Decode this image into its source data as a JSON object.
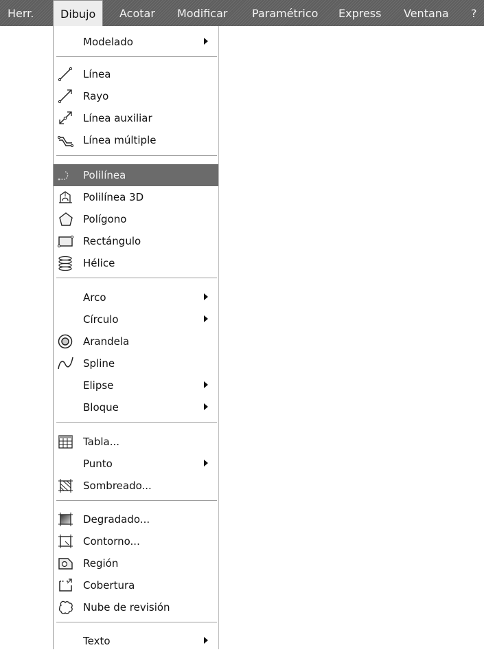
{
  "menubar": {
    "items": [
      "Herr.",
      "Dibujo",
      "Acotar",
      "Modificar",
      "Paramétrico",
      "Express",
      "Ventana",
      "?"
    ],
    "active": "Dibujo"
  },
  "menu": {
    "items": [
      {
        "label": "Modelado",
        "submenu": true,
        "icon": null
      },
      {
        "label": "Línea",
        "submenu": false,
        "icon": "line-icon"
      },
      {
        "label": "Rayo",
        "submenu": false,
        "icon": "ray-icon"
      },
      {
        "label": "Línea auxiliar",
        "submenu": false,
        "icon": "construction-line-icon"
      },
      {
        "label": "Línea múltiple",
        "submenu": false,
        "icon": "multiline-icon"
      },
      {
        "label": "Polilínea",
        "submenu": false,
        "icon": "polyline-icon",
        "highlighted": true
      },
      {
        "label": "Polilínea 3D",
        "submenu": false,
        "icon": "polyline-3d-icon"
      },
      {
        "label": "Polígono",
        "submenu": false,
        "icon": "polygon-icon"
      },
      {
        "label": "Rectángulo",
        "submenu": false,
        "icon": "rectangle-icon"
      },
      {
        "label": "Hélice",
        "submenu": false,
        "icon": "helix-icon"
      },
      {
        "label": "Arco",
        "submenu": true,
        "icon": null
      },
      {
        "label": "Círculo",
        "submenu": true,
        "icon": null
      },
      {
        "label": "Arandela",
        "submenu": false,
        "icon": "donut-icon"
      },
      {
        "label": "Spline",
        "submenu": false,
        "icon": "spline-icon"
      },
      {
        "label": "Elipse",
        "submenu": true,
        "icon": null
      },
      {
        "label": "Bloque",
        "submenu": true,
        "icon": null
      },
      {
        "label": "Tabla...",
        "submenu": false,
        "icon": "table-icon"
      },
      {
        "label": "Punto",
        "submenu": true,
        "icon": null
      },
      {
        "label": "Sombreado...",
        "submenu": false,
        "icon": "hatch-icon"
      },
      {
        "label": "Degradado...",
        "submenu": false,
        "icon": "gradient-icon"
      },
      {
        "label": "Contorno...",
        "submenu": false,
        "icon": "boundary-icon"
      },
      {
        "label": "Región",
        "submenu": false,
        "icon": "region-icon"
      },
      {
        "label": "Cobertura",
        "submenu": false,
        "icon": "wipeout-icon"
      },
      {
        "label": "Nube de revisión",
        "submenu": false,
        "icon": "revision-cloud-icon"
      },
      {
        "label": "Texto",
        "submenu": true,
        "icon": null
      }
    ]
  },
  "colors": {
    "menubar": "#666666",
    "highlight": "#6b6b6b",
    "menu_bg": "#ffffff"
  }
}
